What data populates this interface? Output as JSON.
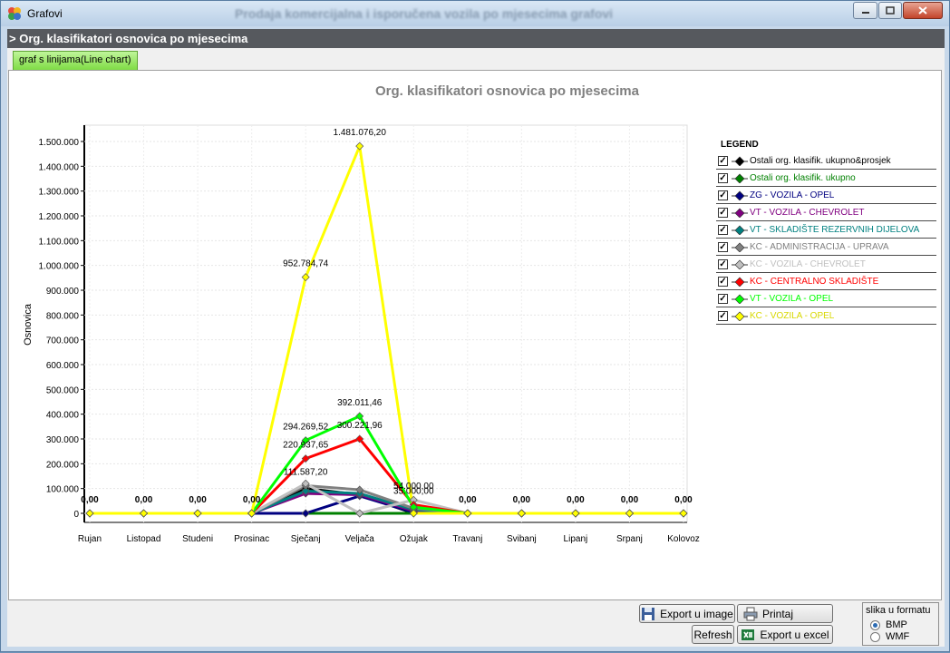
{
  "window": {
    "title": "Grafovi",
    "blurred_title": "Prodaja komercijalna i isporučena vozila po mjesecima grafovi"
  },
  "header": {
    "title": "> Org. klasifikatori osnovica po mjesecima"
  },
  "tabs": [
    {
      "label": "graf s linijama(Line chart)"
    }
  ],
  "legend": {
    "title": "LEGEND",
    "items": [
      {
        "label": "Ostali org. klasifik. ukupno&prosjek",
        "color": "#000000"
      },
      {
        "label": "Ostali org. klasifik. ukupno",
        "color": "#008000"
      },
      {
        "label": "ZG - VOZILA - OPEL",
        "color": "#000080"
      },
      {
        "label": "VT - VOZILA - CHEVROLET",
        "color": "#800080"
      },
      {
        "label": "VT - SKLADIŠTE REZERVNIH DIJELOVA",
        "color": "#008080"
      },
      {
        "label": "KC - ADMINISTRACIJA - UPRAVA",
        "color": "#808080"
      },
      {
        "label": "KC - VOZILA - CHEVROLET",
        "color": "#c0c0c0"
      },
      {
        "label": "KC - CENTRALNO SKLADIŠTE",
        "color": "#ff0000"
      },
      {
        "label": "VT - VOZILA - OPEL",
        "color": "#00ff00"
      },
      {
        "label": "KC - VOZILA - OPEL",
        "color": "#ffff00"
      }
    ]
  },
  "chart_data": {
    "type": "line",
    "title": "Org. klasifikatori osnovica po mjesecima",
    "ylabel": "Osnovica",
    "xlabel": "",
    "categories": [
      "Rujan",
      "Listopad",
      "Studeni",
      "Prosinac",
      "Sječanj",
      "Veljača",
      "Ožujak",
      "Travanj",
      "Svibanj",
      "Lipanj",
      "Srpanj",
      "Kolovoz"
    ],
    "ylim": [
      0,
      1500000
    ],
    "yticks": [
      "0",
      "100.000",
      "200.000",
      "300.000",
      "400.000",
      "500.000",
      "600.000",
      "700.000",
      "800.000",
      "900.000",
      "1.000.000",
      "1.100.000",
      "1.200.000",
      "1.300.000",
      "1.400.000",
      "1.500.000"
    ],
    "grid": true,
    "legend_position": "right",
    "series": [
      {
        "name": "Ostali org. klasifik. ukupno&prosjek",
        "color": "#000000",
        "values": [
          0,
          0,
          0,
          0,
          100000,
          75000,
          0,
          0,
          0,
          0,
          0,
          0
        ]
      },
      {
        "name": "Ostali org. klasifik. ukupno",
        "color": "#008000",
        "values": [
          0,
          0,
          0,
          0,
          0,
          0,
          0,
          0,
          0,
          0,
          0,
          0
        ]
      },
      {
        "name": "ZG - VOZILA - OPEL",
        "color": "#000080",
        "values": [
          0,
          0,
          0,
          0,
          0,
          70000,
          4000,
          0,
          0,
          0,
          0,
          0
        ]
      },
      {
        "name": "VT - VOZILA - CHEVROLET",
        "color": "#800080",
        "values": [
          0,
          0,
          0,
          0,
          80000,
          75000,
          10000,
          0,
          0,
          0,
          0,
          0
        ]
      },
      {
        "name": "VT - SKLADIŠTE REZERVNIH DIJELOVA",
        "color": "#008080",
        "values": [
          0,
          0,
          0,
          0,
          90000,
          80000,
          15000,
          0,
          0,
          0,
          0,
          0
        ]
      },
      {
        "name": "KC - ADMINISTRACIJA - UPRAVA",
        "color": "#808080",
        "values": [
          0,
          0,
          0,
          0,
          111587.2,
          95000,
          20000,
          0,
          0,
          0,
          0,
          0
        ]
      },
      {
        "name": "KC - VOZILA - CHEVROLET",
        "color": "#c0c0c0",
        "values": [
          0,
          0,
          0,
          0,
          120000,
          0,
          54000,
          0,
          0,
          0,
          0,
          0
        ]
      },
      {
        "name": "KC - CENTRALNO SKLADIŠTE",
        "color": "#ff0000",
        "values": [
          0,
          0,
          0,
          0,
          220937.65,
          300221.96,
          35000,
          0,
          0,
          0,
          0,
          0
        ]
      },
      {
        "name": "VT - VOZILA - OPEL",
        "color": "#00ff00",
        "values": [
          0,
          0,
          0,
          0,
          294269.52,
          392011.46,
          25000,
          0,
          0,
          0,
          0,
          0
        ]
      },
      {
        "name": "KC - VOZILA - OPEL",
        "color": "#ffff00",
        "values": [
          0,
          0,
          0,
          0,
          952784.74,
          1481076.2,
          0,
          0,
          0,
          0,
          0,
          0
        ]
      }
    ],
    "data_labels": [
      {
        "text": "0,00",
        "x": "Rujan",
        "y": 0
      },
      {
        "text": "0,00",
        "x": "Listopad",
        "y": 0
      },
      {
        "text": "0,00",
        "x": "Studeni",
        "y": 0
      },
      {
        "text": "0,00",
        "x": "Prosinac",
        "y": 0
      },
      {
        "text": "0,00",
        "x": "Travanj",
        "y": 0
      },
      {
        "text": "0,00",
        "x": "Svibanj",
        "y": 0
      },
      {
        "text": "0,00",
        "x": "Lipanj",
        "y": 0
      },
      {
        "text": "0,00",
        "x": "Srpanj",
        "y": 0
      },
      {
        "text": "0,00",
        "x": "Kolovoz",
        "y": 0
      },
      {
        "text": "1.481.076,20",
        "x": "Veljača",
        "y": 1481076.2
      },
      {
        "text": "952.784,74",
        "x": "Sječanj",
        "y": 952784.74
      },
      {
        "text": "392.011,46",
        "x": "Veljača",
        "y": 392011.46
      },
      {
        "text": "294.269,52",
        "x": "Sječanj",
        "y": 294269.52
      },
      {
        "text": "300.221,96",
        "x": "Veljača",
        "y": 300221.96
      },
      {
        "text": "220.937,65",
        "x": "Sječanj",
        "y": 220937.65
      },
      {
        "text": "111.587,20",
        "x": "Sječanj",
        "y": 111587.2
      },
      {
        "text": "54.000,00",
        "x": "Ožujak",
        "y": 54000
      },
      {
        "text": "35.000,00",
        "x": "Ožujak",
        "y": 35000
      }
    ]
  },
  "buttons": {
    "export_image": "Export u image",
    "print": "Printaj",
    "refresh": "Refresh",
    "export_excel": "Export u excel"
  },
  "format_box": {
    "title": "slika u formatu",
    "options": [
      {
        "label": "BMP",
        "selected": true
      },
      {
        "label": "WMF",
        "selected": false
      }
    ]
  }
}
